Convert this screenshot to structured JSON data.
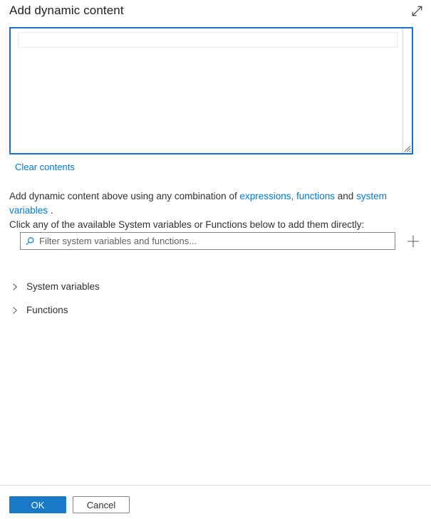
{
  "panel": {
    "title": "Add dynamic content",
    "expand_icon": "expand-diagonal-icon"
  },
  "editor": {
    "value": "",
    "clear_label": "Clear contents"
  },
  "description": {
    "prefix": "Add dynamic content above using any combination of ",
    "link_expressions": "expressions, functions",
    "middle": " and ",
    "link_system_variables": "system variables",
    "suffix": " .",
    "line2": "Click any of the available System variables or Functions below to add them directly:"
  },
  "filter": {
    "value": "",
    "placeholder": "Filter system variables and functions...",
    "search_icon": "search-icon",
    "add_icon": "plus-icon"
  },
  "tree": {
    "items": [
      {
        "label": "System variables",
        "expanded": false,
        "chevron": "chevron-right-icon"
      },
      {
        "label": "Functions",
        "expanded": false,
        "chevron": "chevron-right-icon"
      }
    ]
  },
  "footer": {
    "ok_label": "OK",
    "cancel_label": "Cancel"
  },
  "colors": {
    "accent": "#0078d4",
    "primary_button": "#1a78c8",
    "editor_border": "#1a72c8",
    "text": "#323130",
    "title": "#201f1e",
    "border": "#8a8886",
    "divider": "#e1dfdd"
  }
}
